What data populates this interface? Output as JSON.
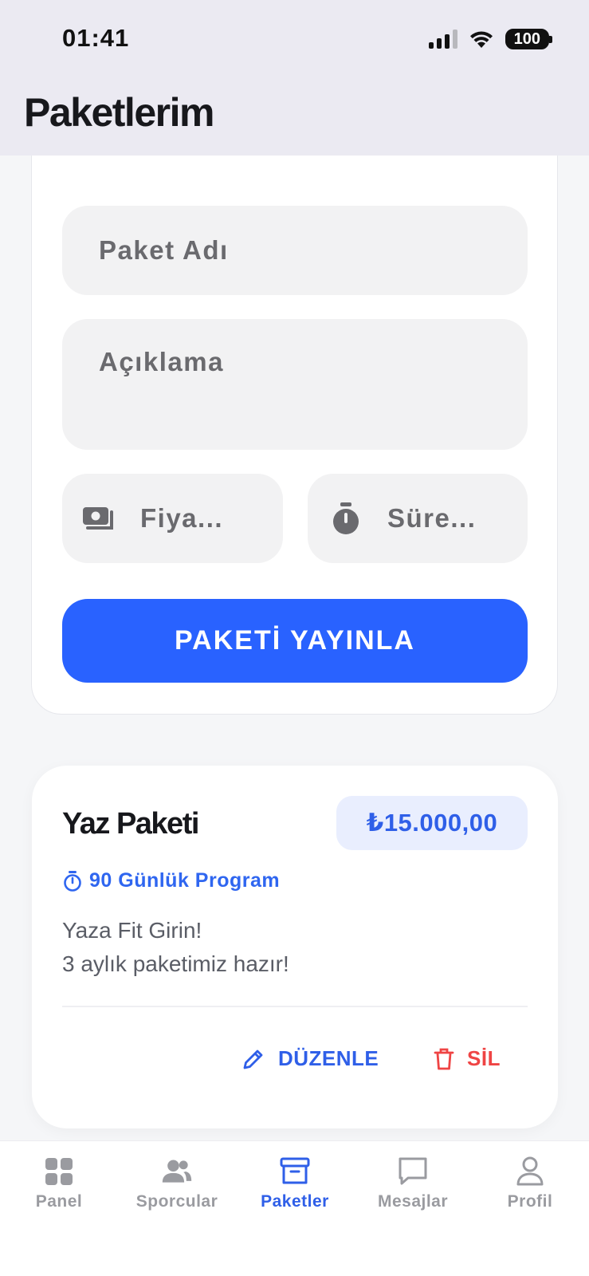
{
  "status_bar": {
    "time": "01:41",
    "battery": "100",
    "icons": [
      "cellular-signal-icon",
      "wifi-icon",
      "battery-icon"
    ]
  },
  "header": {
    "title": "Paketlerim"
  },
  "form": {
    "name_placeholder": "Paket Adı",
    "description_placeholder": "Açıklama",
    "price_placeholder": "Fiya...",
    "duration_placeholder": "Süre...",
    "price_icon": "money-icon",
    "duration_icon": "stopwatch-icon",
    "publish_label": "PAKETİ YAYINLA"
  },
  "package": {
    "title": "Yaz Paketi",
    "price": "₺15.000,00",
    "duration": "90 Günlük Program",
    "description_lines": [
      "Yaza Fit Girin!",
      "3 aylık paketimiz hazır!"
    ],
    "edit_label": "DÜZENLE",
    "delete_label": "SİL"
  },
  "bottom_nav": {
    "items": [
      {
        "label": "Panel",
        "icon": "grid-icon",
        "active": false
      },
      {
        "label": "Sporcular",
        "icon": "users-icon",
        "active": false
      },
      {
        "label": "Paketler",
        "icon": "archive-box-icon",
        "active": true
      },
      {
        "label": "Mesajlar",
        "icon": "chat-bubble-icon",
        "active": false
      },
      {
        "label": "Profil",
        "icon": "person-icon",
        "active": false
      }
    ]
  },
  "colors": {
    "accent": "#2962ff",
    "danger": "#ef4444",
    "header_bg": "#ebeaf2",
    "badge_bg": "#e9eefe"
  }
}
